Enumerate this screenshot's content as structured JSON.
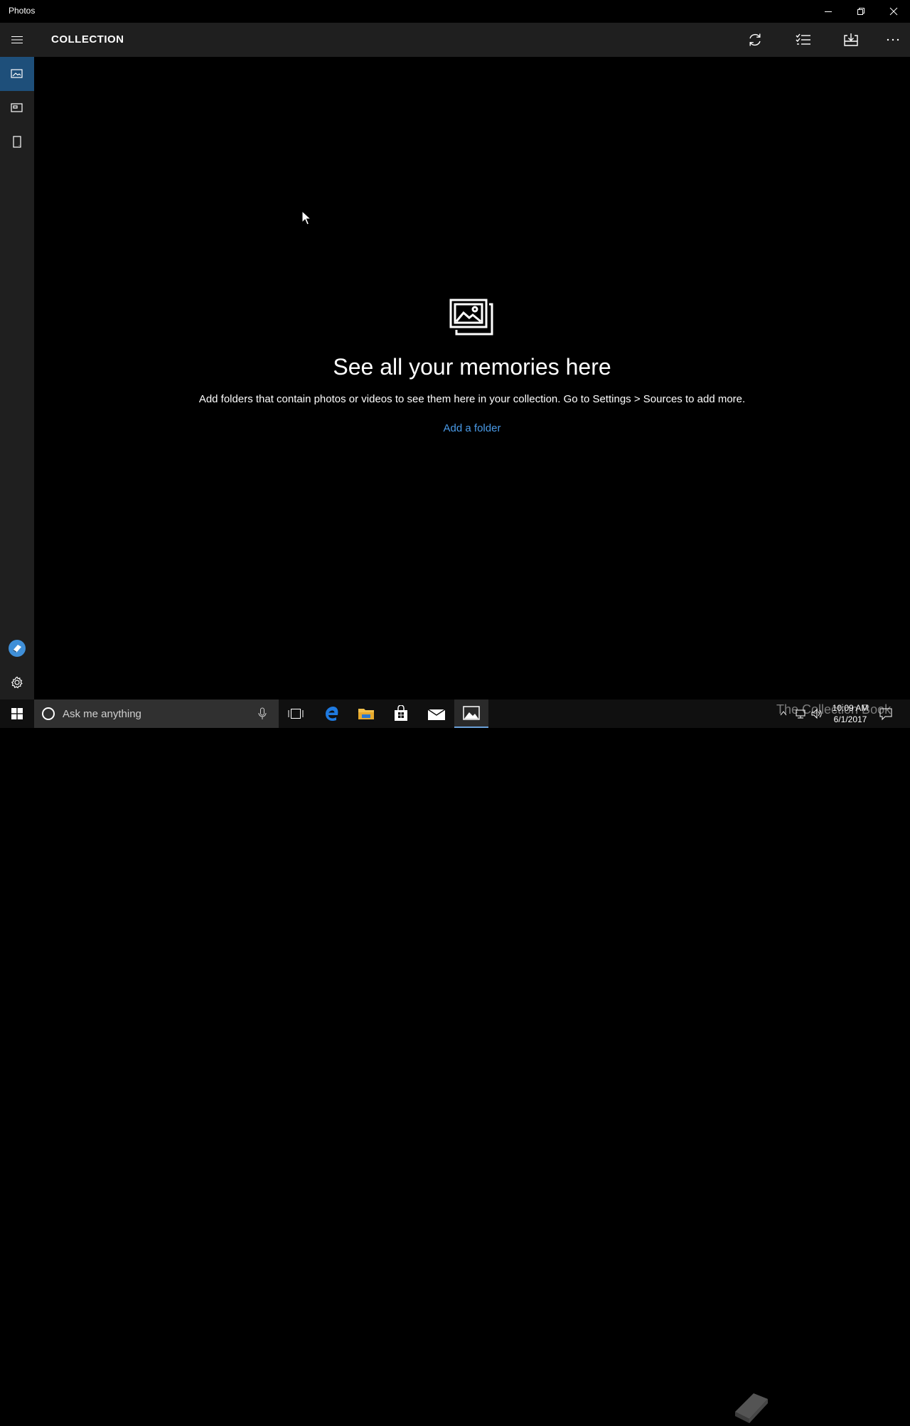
{
  "window": {
    "title": "Photos"
  },
  "header": {
    "title": "COLLECTION"
  },
  "empty_state": {
    "heading": "See all your memories here",
    "description": "Add folders that contain photos or videos to see them here in your collection. Go to Settings > Sources to add more.",
    "link": "Add a folder"
  },
  "taskbar": {
    "search_placeholder": "Ask me anything",
    "time": "10:09 AM",
    "date": "6/1/2017",
    "watermark": "The Collection Book"
  },
  "colors": {
    "accent": "#1e4f7a",
    "link": "#4a9be8",
    "header_bg": "#1f1f1f",
    "background": "#000000"
  },
  "icons": {
    "sidebar": [
      "collection-icon",
      "albums-icon",
      "folders-icon",
      "app-badge-icon",
      "settings-gear-icon"
    ],
    "toolbar": [
      "refresh-icon",
      "select-list-icon",
      "import-icon",
      "more-ellipsis-icon"
    ]
  }
}
